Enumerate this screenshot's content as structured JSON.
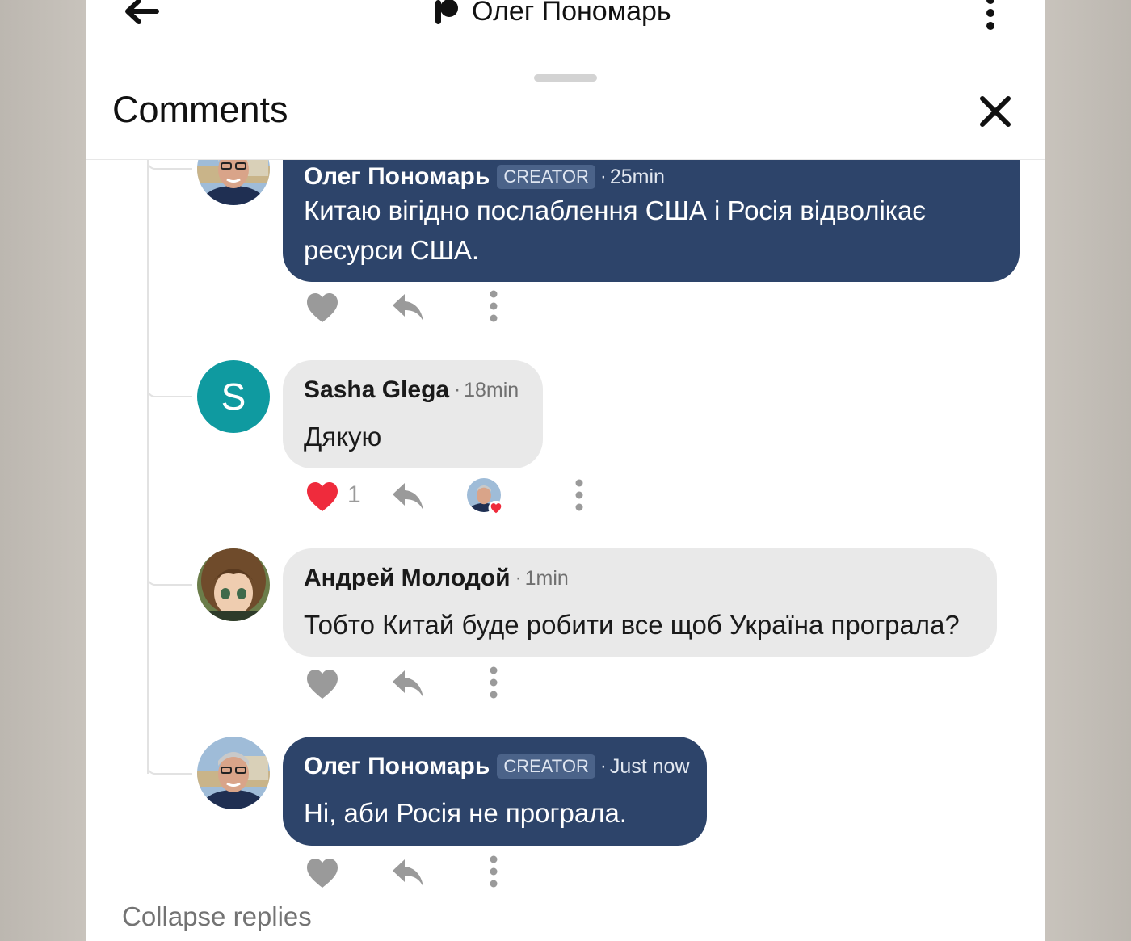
{
  "topbar": {
    "title": "Олег Пономарь",
    "back_icon": "arrow-left-icon",
    "menu_icon": "kebab-icon"
  },
  "sheet": {
    "title": "Comments",
    "close_icon": "close-icon"
  },
  "comments": [
    {
      "author": "Олег Пономарь",
      "badge": "CREATOR",
      "time": "25min",
      "text_lines": [
        "Китаю вігідно послаблення США і Росія відволікає",
        "ресурси США."
      ],
      "liked": false,
      "bubble_color": "#2d446a"
    },
    {
      "author": "Sasha Glega",
      "avatar_letter": "S",
      "time": "18min",
      "text": "Дякую",
      "liked": true,
      "like_count": "1",
      "bubble_color": "#e9e9e9"
    },
    {
      "author": "Андрей Молодой",
      "time": "1min",
      "text": "Тобто Китай буде робити все щоб Україна програла?",
      "liked": false,
      "bubble_color": "#e9e9e9"
    },
    {
      "author": "Олег Пономарь",
      "badge": "CREATOR",
      "time": "Just now",
      "text": "Ні, аби Росія не програла.",
      "liked": false,
      "bubble_color": "#2d446a"
    }
  ],
  "dot": "·",
  "collapse_label": "Collapse replies",
  "colors": {
    "creator_bubble": "#2d446a",
    "teal_avatar": "#0f9aa0",
    "like_red": "#ef2b3c",
    "icon_gray": "#9a9a9a"
  }
}
